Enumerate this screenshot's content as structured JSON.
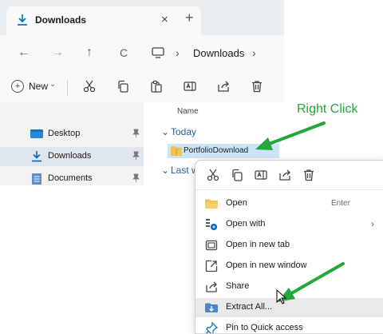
{
  "tab": {
    "title": "Downloads",
    "close": "×",
    "new_tab": "+"
  },
  "nav": {
    "back": "←",
    "forward": "→",
    "up": "↑",
    "refresh": "C",
    "sep1": "›",
    "location": "Downloads",
    "sep2": "›"
  },
  "toolbar": {
    "new_label": "New",
    "new_caret": "⌄"
  },
  "sidebar": {
    "items": [
      {
        "label": "Desktop",
        "icon": "desktop-icon",
        "pin": "📌"
      },
      {
        "label": "Downloads",
        "icon": "download-icon",
        "pin": "📌"
      },
      {
        "label": "Documents",
        "icon": "documents-icon",
        "pin": "📌"
      }
    ]
  },
  "content": {
    "column_name": "Name",
    "group_today": "Today",
    "file_name": "PortfolioDownload",
    "group_last": "Last w"
  },
  "annotation": {
    "text": "Right Click",
    "color": "#22a83a"
  },
  "context_menu": {
    "items": [
      {
        "label": "Open",
        "shortcut": "Enter",
        "icon": "folder-icon"
      },
      {
        "label": "Open with",
        "submenu": "›",
        "icon": "open-with-icon"
      },
      {
        "label": "Open in new tab",
        "icon": "new-tab-icon"
      },
      {
        "label": "Open in new window",
        "icon": "new-window-icon"
      },
      {
        "label": "Share",
        "icon": "share-icon"
      },
      {
        "label": "Extract All...",
        "icon": "extract-icon"
      },
      {
        "label": "Pin to Quick access",
        "icon": "pin-icon"
      }
    ]
  },
  "colors": {
    "accent": "#0067c0",
    "folder": "#f2c14e",
    "arrow": "#22a83a",
    "selection": "#cce4f7"
  }
}
